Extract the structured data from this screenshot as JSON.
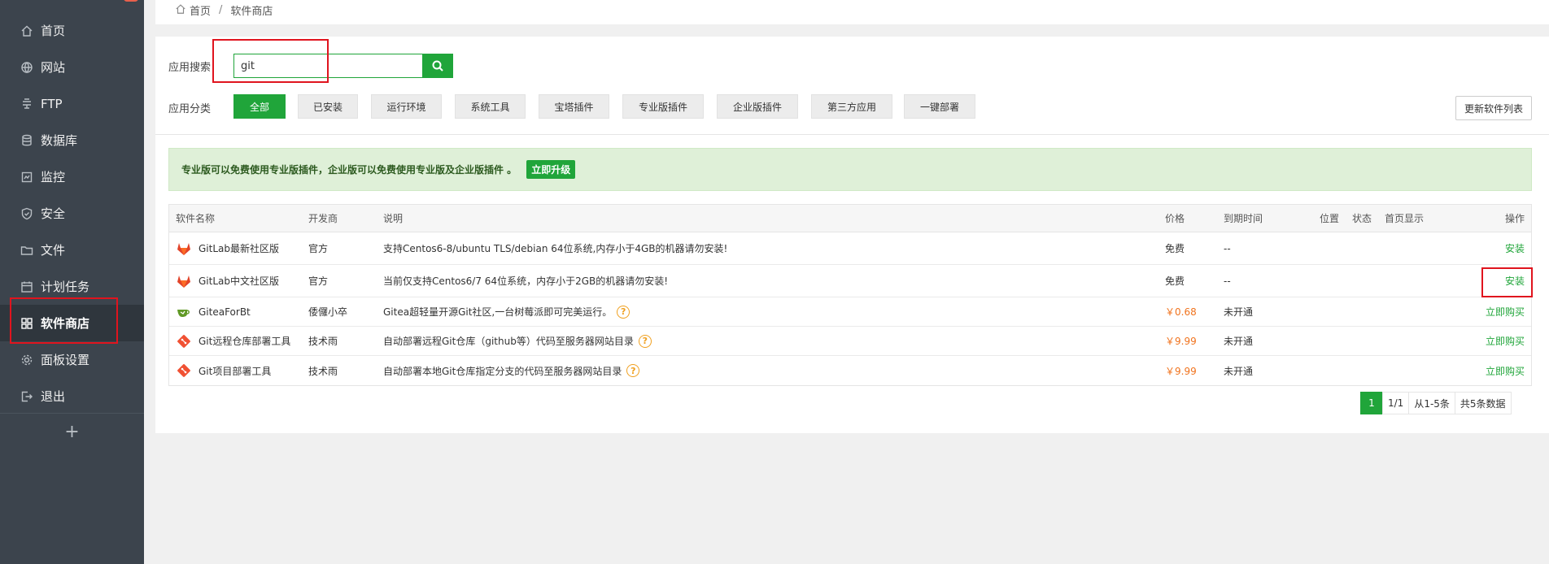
{
  "sidebar": {
    "items": [
      {
        "label": "首页",
        "icon": "home-icon"
      },
      {
        "label": "网站",
        "icon": "globe-icon"
      },
      {
        "label": "FTP",
        "icon": "ftp-icon"
      },
      {
        "label": "数据库",
        "icon": "database-icon"
      },
      {
        "label": "监控",
        "icon": "monitor-icon"
      },
      {
        "label": "安全",
        "icon": "shield-icon"
      },
      {
        "label": "文件",
        "icon": "folder-icon"
      },
      {
        "label": "计划任务",
        "icon": "calendar-icon"
      },
      {
        "label": "软件商店",
        "icon": "apps-icon"
      },
      {
        "label": "面板设置",
        "icon": "gear-icon"
      },
      {
        "label": "退出",
        "icon": "logout-icon"
      }
    ],
    "active": "软件商店",
    "add_label": "+"
  },
  "breadcrumb": {
    "home": "首页",
    "separator": "/",
    "current": "软件商店"
  },
  "search": {
    "label": "应用搜索",
    "value": "git"
  },
  "categories": {
    "label": "应用分类",
    "items": [
      "全部",
      "已安装",
      "运行环境",
      "系统工具",
      "宝塔插件",
      "专业版插件",
      "企业版插件",
      "第三方应用",
      "一键部署"
    ],
    "active": "全部"
  },
  "refresh_label": "更新软件列表",
  "notice": {
    "text": "专业版可以免费使用专业版插件，企业版可以免费使用专业版及企业版插件 。",
    "button": "立即升级"
  },
  "table": {
    "headers": {
      "name": "软件名称",
      "dev": "开发商",
      "desc": "说明",
      "price": "价格",
      "expire": "到期时间",
      "position": "位置",
      "state": "状态",
      "home": "首页显示",
      "op": "操作"
    },
    "rows": [
      {
        "name": "GitLab最新社区版",
        "dev": "官方",
        "desc": "支持Centos6-8/ubuntu TLS/debian 64位系统,内存小于4GB的机器请勿安装!",
        "price": "免费",
        "expire": "--",
        "op": "安装",
        "icon": "gitlab-icon"
      },
      {
        "name": "GitLab中文社区版",
        "dev": "官方",
        "desc": "当前仅支持Centos6/7 64位系统，内存小于2GB的机器请勿安装!",
        "price": "免费",
        "expire": "--",
        "op": "安装",
        "icon": "gitlab-icon"
      },
      {
        "name": "GiteaForBt",
        "dev": "倭儸小卒",
        "desc": "Gitea超轻量开源Git社区,一台树莓派即可完美运行。",
        "price": "￥0.68",
        "expire": "未开通",
        "op": "立即购买",
        "icon": "gitea-icon"
      },
      {
        "name": "Git远程仓库部署工具",
        "dev": "技术雨",
        "desc": "自动部署远程Git仓库（github等）代码至服务器网站目录",
        "price": "￥9.99",
        "expire": "未开通",
        "op": "立即购买",
        "icon": "git-icon"
      },
      {
        "name": "Git项目部署工具",
        "dev": "技术雨",
        "desc": "自动部署本地Git仓库指定分支的代码至服务器网站目录",
        "price": "￥9.99",
        "expire": "未开通",
        "op": "立即购买",
        "icon": "git-icon"
      }
    ]
  },
  "pagination": {
    "current": "1",
    "pages": "1/1",
    "range": "从1-5条",
    "total": "共5条数据"
  },
  "colors": {
    "accent": "#20a53a",
    "sidebar_bg": "#3c444d",
    "price_red": "#f0731e",
    "highlight": "#e0141e"
  }
}
